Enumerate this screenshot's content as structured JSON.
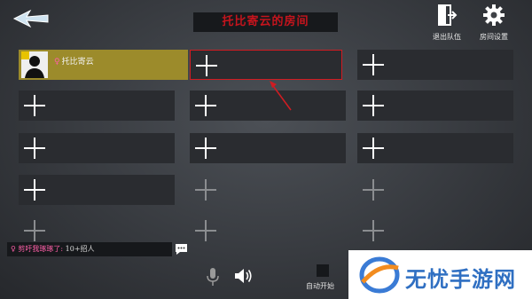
{
  "room": {
    "title": "托比寄云的房间"
  },
  "top_buttons": {
    "leave_team": "退出队伍",
    "room_settings": "房间设置"
  },
  "player": {
    "name": "托比寄云"
  },
  "chat": {
    "sender": "剪吁我琢琢了:",
    "message": "10+招人"
  },
  "auto_start": {
    "label": "自动开始"
  },
  "watermark": {
    "text": "无忧手游网"
  },
  "colors": {
    "title_red": "#c5141d",
    "occupied_gold": "#9c8b2b",
    "selected_border": "#d11c22",
    "watermark_blue": "#2f6fc2"
  }
}
